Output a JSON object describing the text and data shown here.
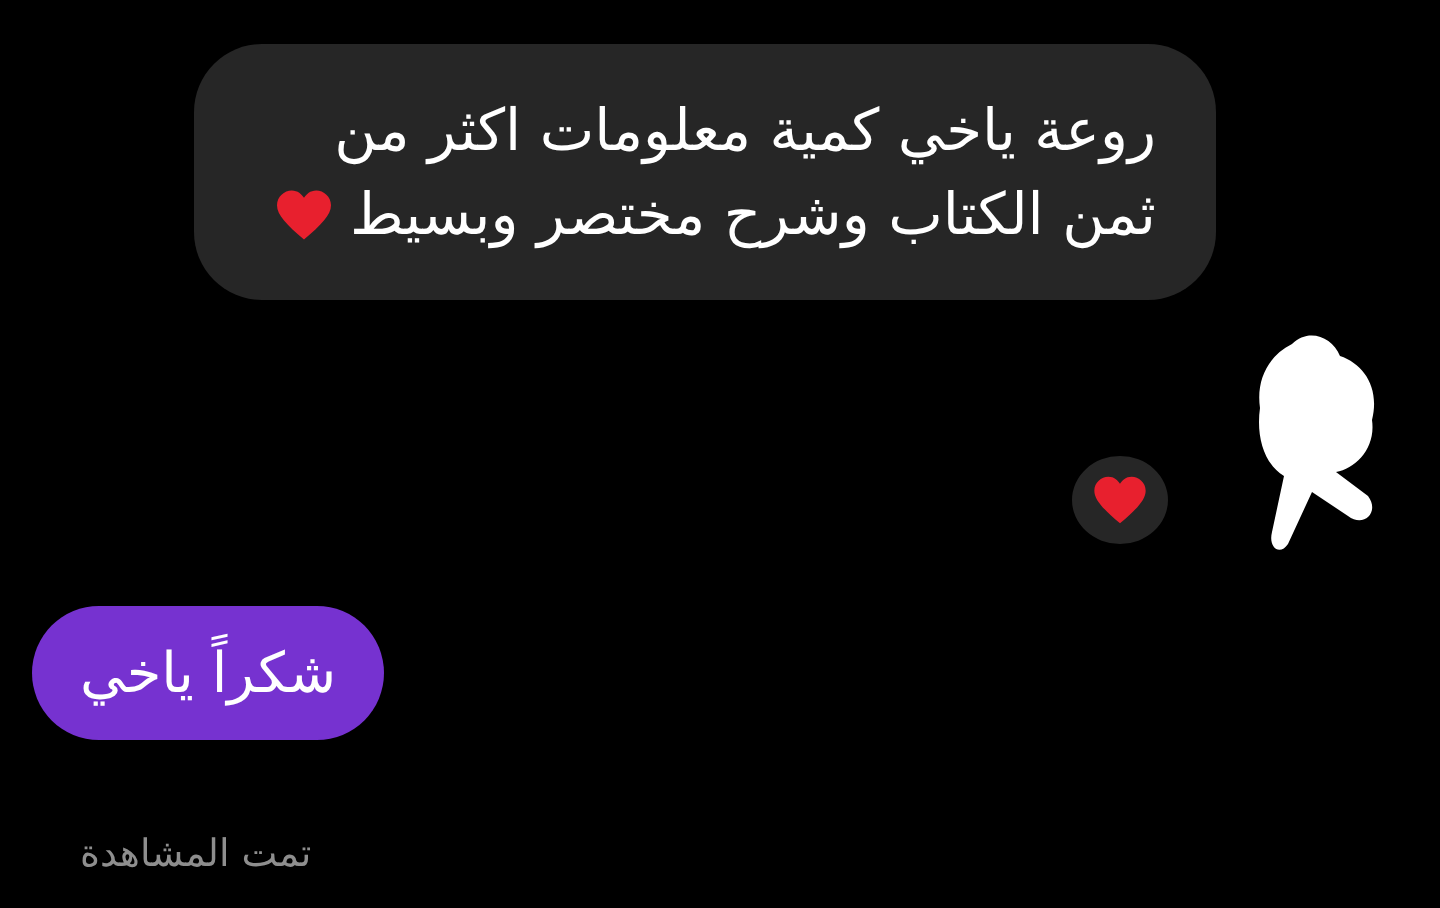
{
  "messages": [
    {
      "kind": "incoming",
      "text": "روعة ياخي كمية معلومات اكثر من ثمن الكتاب وشرح مختصر وبسيط",
      "reacted": true
    },
    {
      "kind": "outgoing",
      "text": "شكراً ياخي"
    }
  ],
  "status": "تمت المشاهدة"
}
